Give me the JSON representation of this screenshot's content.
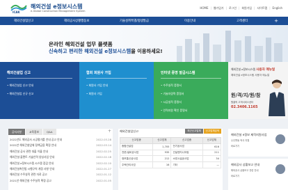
{
  "header": {
    "logo_title": "해외건설 e정보시스템",
    "logo_sub": "e-Global Construction Management System",
    "logo_abbr": "ICAK",
    "util_links": [
      "HOME",
      "웹가입거",
      "로그인",
      "회원가입",
      "사이트맵",
      "English"
    ]
  },
  "nav": {
    "items": [
      "해외건설업신고",
      "해외공사상황행동보",
      "기술성취특별/평생발급",
      "이용안내",
      "고객센터"
    ],
    "plus": "+"
  },
  "hero": {
    "line1": "온라인 해외건설 업무 플랫폼",
    "line2_accent": "신속하고 편리한 해외건설 e정보시스템",
    "line2_rest": "을 이용하세요!"
  },
  "cards": [
    {
      "title": "해외건설업 신고",
      "links": [
        "해외건설업 신고 안내",
        "해외건설업 신규 신고"
      ],
      "color": "#1c4e96"
    },
    {
      "title": "협회 회원사 가입",
      "links": [
        "회원사 가입 안내",
        "회원사 가입"
      ],
      "color": "#1f8fcf"
    },
    {
      "title": "인터넷 증명 발급시스템",
      "links": [
        "수주실적 증명서",
        "기술자경력 증명서",
        "시공실적 증명서",
        "인력지원 확인 증명서"
      ],
      "color": "#3aab5b"
    }
  ],
  "promo": {
    "text_prefix": "해외건설 e정보시스템",
    "text_accent": "사용자 매뉴얼",
    "sub": "해외건설 e정보시스템 사용자 매뉴얼",
    "big": "원/격/지/원/참",
    "desc": "원클릭 고객서비스센터",
    "phone": "02.3406.1165"
  },
  "notice": {
    "tabs": [
      "공지사항",
      "교육정보",
      "Q&A"
    ],
    "plus": "+",
    "rows": [
      {
        "title": "2022년도 해외공사 시공평가를 안내 공고 안내",
        "date": "2022.03.28"
      },
      {
        "title": "2022년 해외건설업체 정책금융 확정 안내",
        "date": "2022.03.14"
      },
      {
        "title": "해외건설 공사 관련 대출 이율 안내",
        "date": "2022.02.25"
      },
      {
        "title": "해외건설·플랜트 기술인력 양성사업 안내",
        "date": "2022.02.18"
      },
      {
        "title": "해외건설 e정보시스템 시스템 점검 안내",
        "date": "2022.02.10"
      },
      {
        "title": "해외건설촉진법 시행규칙 개정 사항 안내",
        "date": "2022.01.27"
      },
      {
        "title": "해외건설 수주실적 관련 자료 공고",
        "date": "2022.01.12"
      },
      {
        "title": "2021년 해외건설 수주실적 확정 공고",
        "date": "2022.01.05"
      }
    ]
  },
  "registry": {
    "title": "해외건설업신고",
    "btn1": "최근신고업체",
    "btn2": "신고업체검색",
    "headers": [
      "신고업종",
      "신고업체",
      "신고업종",
      "신고업체"
    ],
    "rows": [
      [
        "종합건설업",
        "1,705",
        "전기공사업",
        "616"
      ],
      [
        "전문/설비공사업",
        "935",
        "건설엔지니어링",
        "211"
      ],
      [
        "정보통신공사업",
        "212",
        "소방시설공사업",
        "34"
      ],
      [
        "주택관리사업",
        "16",
        "기타",
        "—"
      ]
    ]
  },
  "rbox1": {
    "title": "해외건설 e정보 제작지원사업",
    "sub": "수주활동 적극 지원",
    "link": "바로가기"
  },
  "rbox2": {
    "title": "해외공사 상황보고 안내",
    "sub": "해외공사 상황보고 관련 안내",
    "link": "바로가기"
  }
}
